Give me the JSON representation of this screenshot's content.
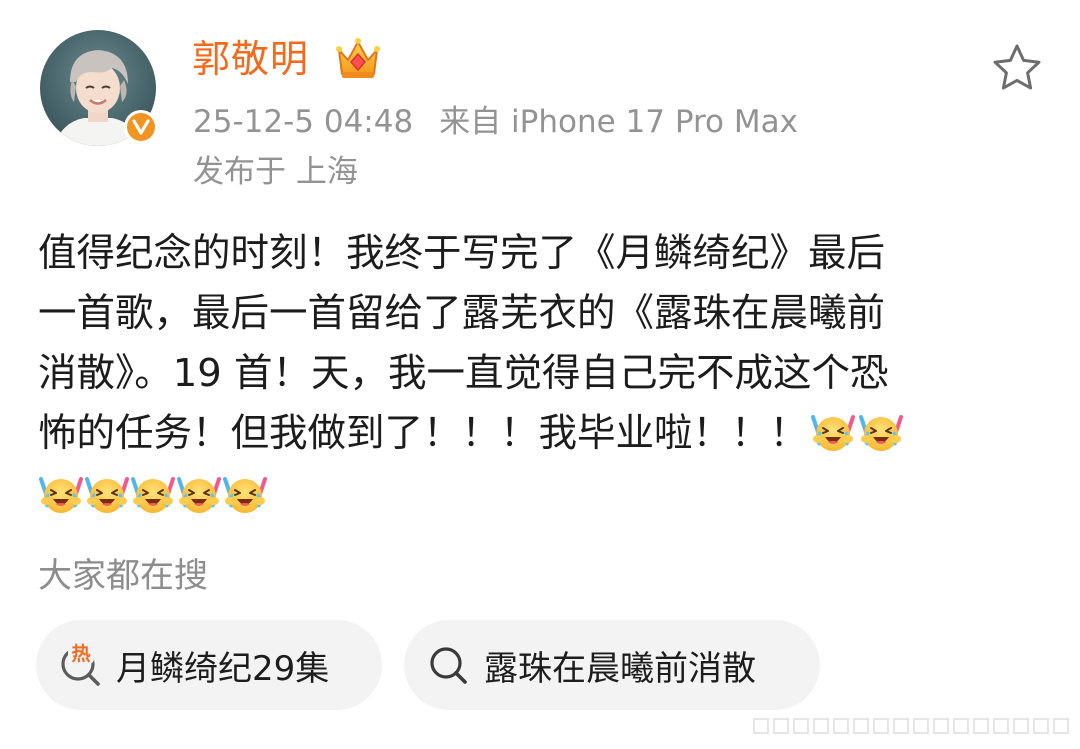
{
  "post": {
    "author": "郭敬明",
    "timestamp": "25-12-5 04:48",
    "source": "来自 iPhone 17 Pro Max",
    "location": "发布于 上海",
    "text_lines": [
      "值得纪念的时刻！我终于写完了《月鳞绮纪》最后",
      "一首歌，最后一首留给了露芜衣的《露珠在晨曦前",
      "消散》。19 首！天，我一直觉得自己完不成这个恐",
      "怖的任务！但我做到了！！！我毕业啦！！！"
    ],
    "emoji_name": "crying-laughing-cheer-emoji"
  },
  "search": {
    "title": "大家都在搜",
    "items": [
      {
        "label": "月鳞绮纪29集",
        "icon": "hot-search-icon",
        "icon_text": "热"
      },
      {
        "label": "露珠在晨曦前消散",
        "icon": "search-icon"
      }
    ]
  },
  "colors": {
    "accent": "#f26a1b",
    "meta": "#939393",
    "pill_bg": "#f3f3f3",
    "hot": "#f06c25"
  }
}
